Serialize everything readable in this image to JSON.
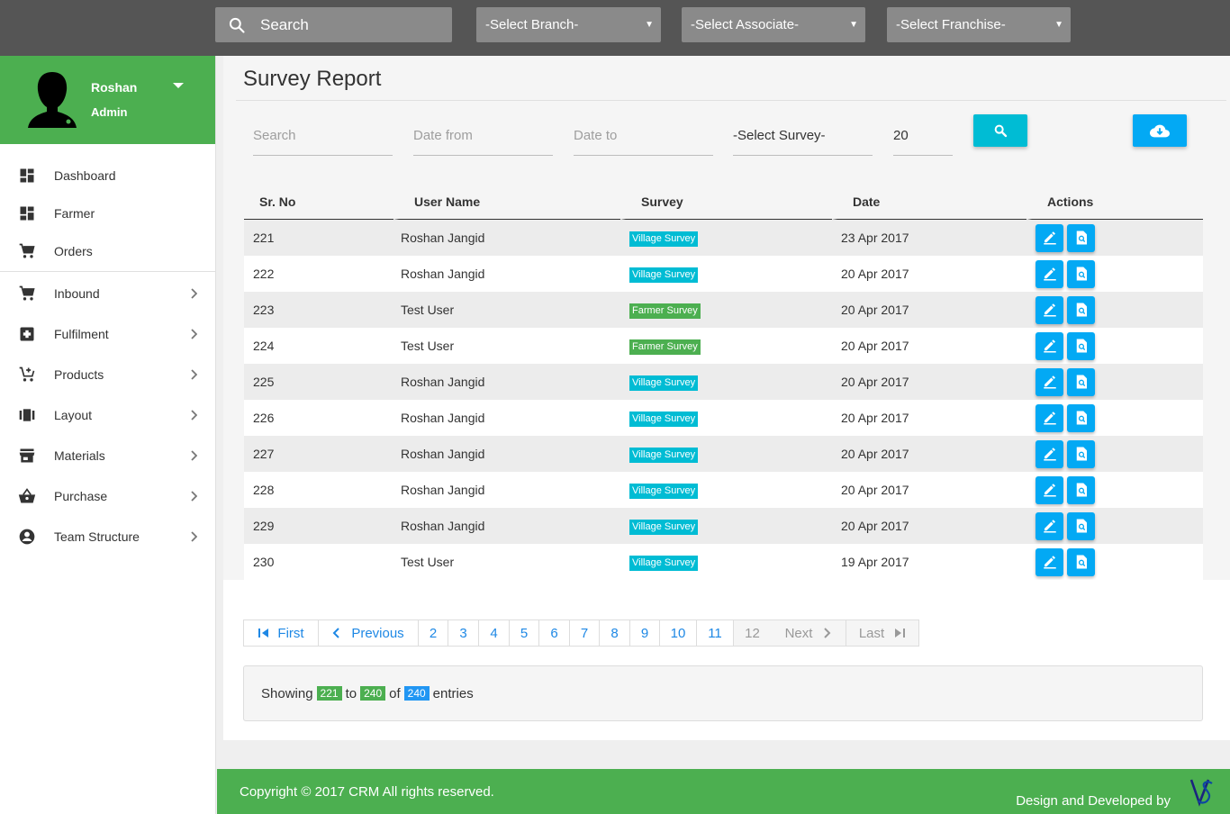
{
  "topbar": {
    "search_placeholder": "Search",
    "branch": "-Select Branch-",
    "associate": "-Select Associate-",
    "franchise": "-Select Franchise-"
  },
  "user": {
    "name": "Roshan",
    "role": "Admin"
  },
  "sidebar": {
    "items": [
      {
        "label": "Dashboard",
        "icon": "dashboard-icon"
      },
      {
        "label": "Farmer",
        "icon": "dashboard-icon"
      },
      {
        "label": "Orders",
        "icon": "cart-icon"
      },
      {
        "label": "Inbound",
        "icon": "cart-icon"
      },
      {
        "label": "Fulfilment",
        "icon": "box-icon"
      },
      {
        "label": "Products",
        "icon": "add-cart-icon"
      },
      {
        "label": "Layout",
        "icon": "view-array-icon"
      },
      {
        "label": "Materials",
        "icon": "store-icon"
      },
      {
        "label": "Purchase",
        "icon": "basket-icon"
      },
      {
        "label": "Team Structure",
        "icon": "account-circle-icon"
      }
    ]
  },
  "page": {
    "title": "Survey Report"
  },
  "filters": {
    "search": "Search",
    "date_from": "Date from",
    "date_to": "Date to",
    "survey": "-Select Survey-",
    "page_size": "20"
  },
  "table": {
    "headers": [
      "Sr. No",
      "User Name",
      "Survey",
      "Date",
      "Actions"
    ],
    "rows": [
      {
        "sr": "221",
        "user": "Roshan Jangid",
        "survey": "Village Survey",
        "date": "23 Apr 2017"
      },
      {
        "sr": "222",
        "user": "Roshan Jangid",
        "survey": "Village Survey",
        "date": "20 Apr 2017"
      },
      {
        "sr": "223",
        "user": "Test User",
        "survey": "Farmer Survey",
        "date": "20 Apr 2017"
      },
      {
        "sr": "224",
        "user": "Test User",
        "survey": "Farmer Survey",
        "date": "20 Apr 2017"
      },
      {
        "sr": "225",
        "user": "Roshan Jangid",
        "survey": "Village Survey",
        "date": "20 Apr 2017"
      },
      {
        "sr": "226",
        "user": "Roshan Jangid",
        "survey": "Village Survey",
        "date": "20 Apr 2017"
      },
      {
        "sr": "227",
        "user": "Roshan Jangid",
        "survey": "Village Survey",
        "date": "20 Apr 2017"
      },
      {
        "sr": "228",
        "user": "Roshan Jangid",
        "survey": "Village Survey",
        "date": "20 Apr 2017"
      },
      {
        "sr": "229",
        "user": "Roshan Jangid",
        "survey": "Village Survey",
        "date": "20 Apr 2017"
      },
      {
        "sr": "230",
        "user": "Test User",
        "survey": "Village Survey",
        "date": "19 Apr 2017"
      }
    ]
  },
  "pagination": {
    "first": "First",
    "previous": "Previous",
    "pages": [
      "2",
      "3",
      "4",
      "5",
      "6",
      "7",
      "8",
      "9",
      "10",
      "11",
      "12"
    ],
    "next": "Next",
    "last": "Last"
  },
  "info": {
    "showing": "Showing",
    "from": "221",
    "to_word": "to",
    "to": "240",
    "of_word": "of",
    "total": "240",
    "entries": "entries"
  },
  "footer": {
    "copyright": "Copyright © 2017 CRM All rights reserved.",
    "dev": "Design and Developed by"
  },
  "colors": {
    "green": "#4caf50",
    "cyan": "#00bcd4",
    "blue": "#03a9f4",
    "topbar": "#555555"
  }
}
